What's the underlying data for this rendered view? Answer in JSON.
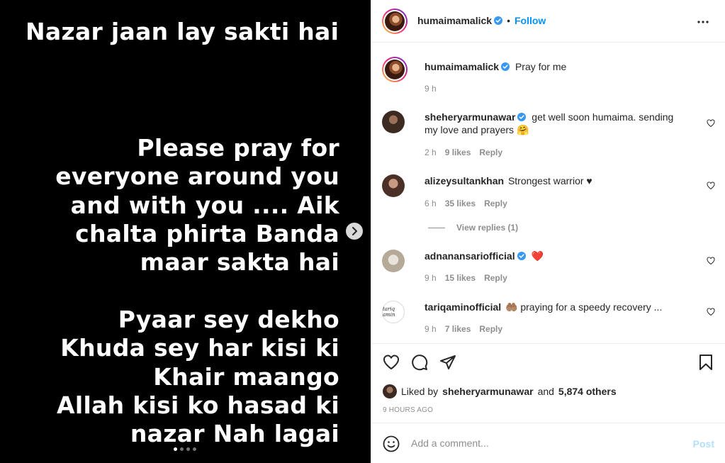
{
  "media": {
    "title_line": "Nazar jaan lay sakti hai",
    "block1": [
      "Please pray for",
      "everyone around you",
      "and with you .... Aik",
      "chalta phirta Banda",
      "maar sakta hai"
    ],
    "block2": [
      "Pyaar sey dekho",
      "Khuda sey har kisi ki",
      "Khair maango",
      "Allah kisi ko hasad ki",
      "nazar Nah lagai"
    ],
    "carousel_count": 4,
    "carousel_active": 1
  },
  "header": {
    "username": "humaimamalick",
    "separator": "•",
    "follow_label": "Follow"
  },
  "caption": {
    "username": "humaimamalick",
    "text": "Pray for me",
    "time": "9 h"
  },
  "comments": [
    {
      "username": "sheheryarmunawar",
      "verified": true,
      "text": "get well soon humaima. sending my love and prayers 🤗",
      "time": "2 h",
      "likes": "9 likes",
      "reply": "Reply"
    },
    {
      "username": "alizeysultankhan",
      "verified": false,
      "text": "Strongest warrior ♥",
      "time": "6 h",
      "likes": "35 likes",
      "reply": "Reply",
      "view_replies": "View replies (1)"
    },
    {
      "username": "adnanansariofficial",
      "verified": true,
      "text": "❤️",
      "time": "9 h",
      "likes": "15 likes",
      "reply": "Reply"
    },
    {
      "username": "tariqaminofficial",
      "verified": false,
      "text": "🤲🏽 praying for a speedy recovery ...",
      "time": "9 h",
      "likes": "7 likes",
      "reply": "Reply",
      "avatar_text": "tariq amin"
    }
  ],
  "likes": {
    "prefix": "Liked by",
    "user": "sheheryarmunawar",
    "and": "and",
    "others": "5,874 others"
  },
  "timestamp": "9 HOURS AGO",
  "add_comment": {
    "placeholder": "Add a comment...",
    "post_label": "Post"
  },
  "colors": {
    "link_blue": "#0095f6",
    "muted": "#8e8e8e",
    "verified_blue": "#3897f0",
    "heart_red": "#ed4956"
  }
}
